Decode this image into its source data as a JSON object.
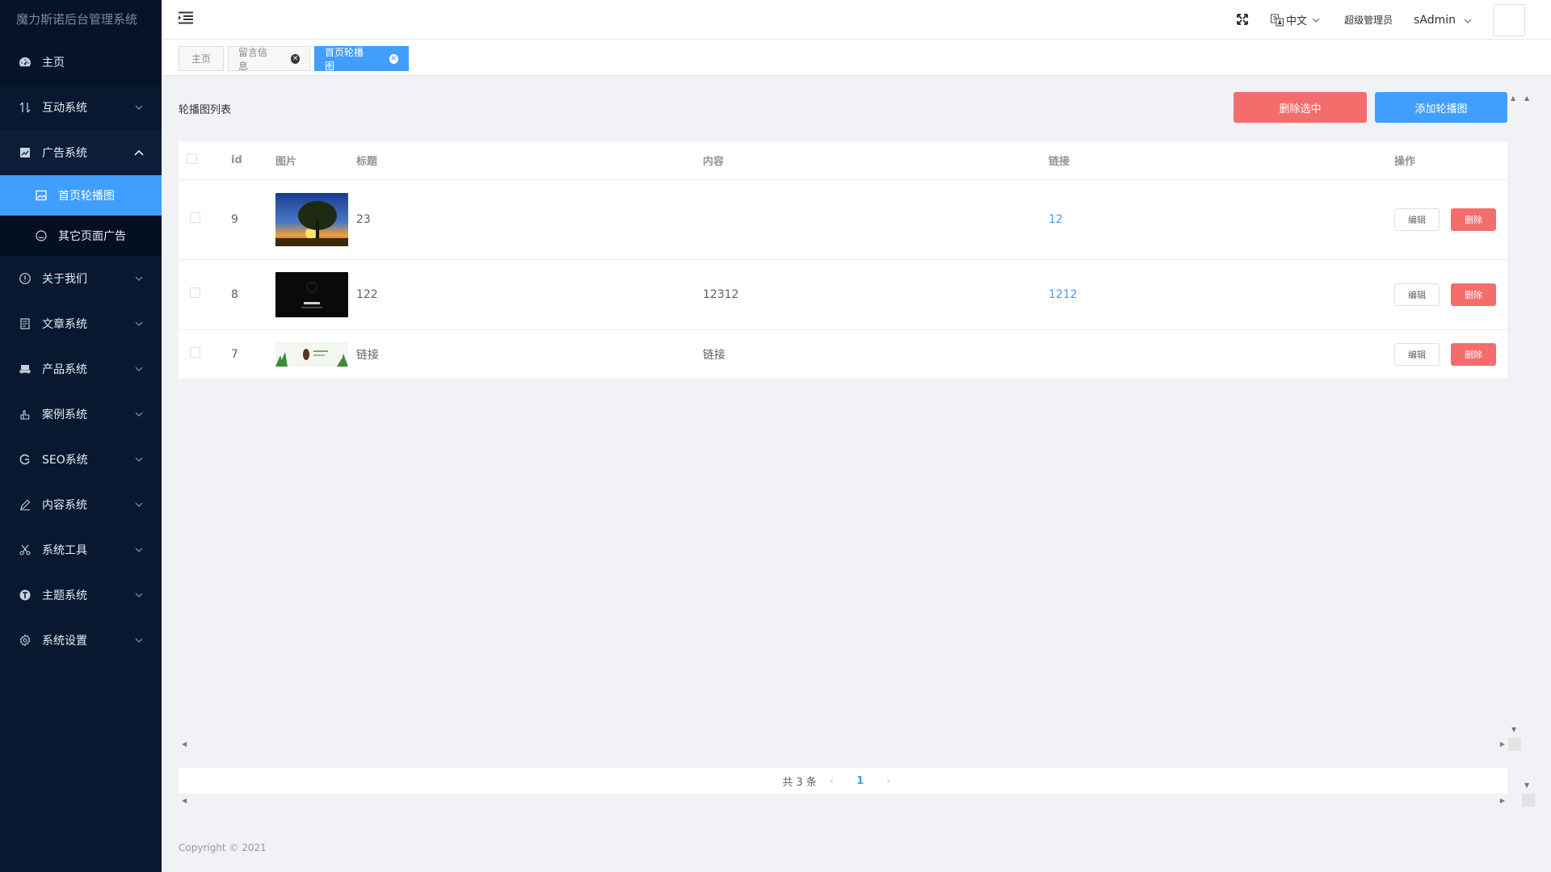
{
  "app": {
    "title": "魔力斯诺后台管理系统"
  },
  "sidebar": {
    "items": [
      {
        "label": "主页",
        "icon": "dashboard-icon"
      },
      {
        "label": "互动系统",
        "icon": "interact-icon"
      },
      {
        "label": "广告系统",
        "icon": "chart-icon"
      },
      {
        "label": "关于我们",
        "icon": "info-icon"
      },
      {
        "label": "文章系统",
        "icon": "document-icon"
      },
      {
        "label": "产品系统",
        "icon": "product-icon"
      },
      {
        "label": "案例系统",
        "icon": "hand-icon"
      },
      {
        "label": "SEO系统",
        "icon": "seo-icon"
      },
      {
        "label": "内容系统",
        "icon": "edit-icon"
      },
      {
        "label": "系统工具",
        "icon": "scissors-icon"
      },
      {
        "label": "主题系统",
        "icon": "theme-icon"
      },
      {
        "label": "系统设置",
        "icon": "gear-icon"
      }
    ],
    "sub_items": [
      {
        "label": "首页轮播图",
        "icon": "picture-icon"
      },
      {
        "label": "其它页面广告",
        "icon": "smile-icon"
      }
    ]
  },
  "header": {
    "language": "中文",
    "role": "超级管理员",
    "username": "sAdmin"
  },
  "tabs": [
    {
      "label": "主页"
    },
    {
      "label": "留言信息"
    },
    {
      "label": "首页轮播图"
    }
  ],
  "main": {
    "list_title": "轮播图列表",
    "delete_selected": "删除选中",
    "add_button": "添加轮播图"
  },
  "table": {
    "columns": [
      "id",
      "图片",
      "标题",
      "内容",
      "链接",
      "操作"
    ],
    "rows": [
      {
        "id": "9",
        "image": "sunset-tree-image",
        "title": "23",
        "content": "",
        "link": "12",
        "edit": "编辑",
        "delete": "删除"
      },
      {
        "id": "8",
        "image": "dark-banner-image",
        "title": "122",
        "content": "12312",
        "link": "1212",
        "edit": "编辑",
        "delete": "删除"
      },
      {
        "id": "7",
        "image": "green-banner-image",
        "title": "链接",
        "content": "链接",
        "link": "",
        "edit": "编辑",
        "delete": "删除"
      }
    ]
  },
  "pagination": {
    "total": "共 3 条",
    "current": "1"
  },
  "footer": {
    "copyright": "Copyright © 2021"
  },
  "colors": {
    "sidebar_bg": "#081830",
    "accent": "#409eff",
    "danger": "#f56c6c"
  }
}
